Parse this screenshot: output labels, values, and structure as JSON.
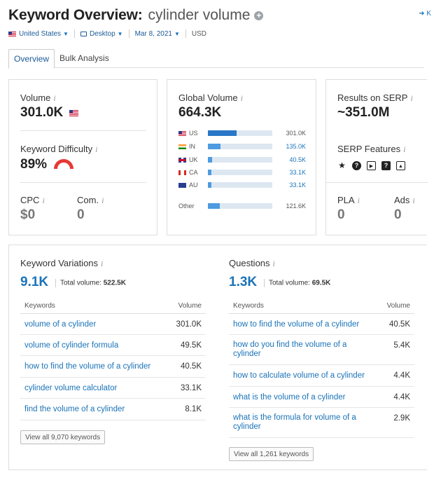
{
  "header": {
    "title": "Keyword Overview:",
    "keyword": "cylinder volume",
    "add_icon": "plus-circle-icon",
    "kb_link": "K"
  },
  "filters": {
    "country": "United States",
    "device": "Desktop",
    "date": "Mar 8, 2021",
    "currency": "USD"
  },
  "tabs": [
    {
      "label": "Overview",
      "active": true
    },
    {
      "label": "Bulk Analysis",
      "active": false
    }
  ],
  "summary": {
    "volume": {
      "label": "Volume",
      "value": "301.0K"
    },
    "difficulty": {
      "label": "Keyword Difficulty",
      "value": "89%",
      "color": "#e53935"
    },
    "cpc": {
      "label": "CPC",
      "value": "$0"
    },
    "com": {
      "label": "Com.",
      "value": "0"
    }
  },
  "global": {
    "label": "Global Volume",
    "value": "664.3K",
    "countries": [
      {
        "code": "US",
        "value": "301.0K",
        "share": 0.45,
        "link": false
      },
      {
        "code": "IN",
        "value": "135.0K",
        "share": 0.2,
        "link": true
      },
      {
        "code": "UK",
        "value": "40.5K",
        "share": 0.06,
        "link": true
      },
      {
        "code": "CA",
        "value": "33.1K",
        "share": 0.05,
        "link": true
      },
      {
        "code": "AU",
        "value": "33.1K",
        "share": 0.05,
        "link": true
      }
    ],
    "other": {
      "label": "Other",
      "value": "121.6K",
      "share": 0.18
    }
  },
  "serp": {
    "results": {
      "label": "Results on SERP",
      "value": "~351.0M"
    },
    "features": {
      "label": "SERP Features",
      "icons": [
        "star-icon",
        "question-circle-icon",
        "video-play-icon",
        "faq-icon",
        "image-icon"
      ]
    },
    "pla": {
      "label": "PLA",
      "value": "0"
    },
    "ads": {
      "label": "Ads",
      "value": "0"
    }
  },
  "variations": {
    "title": "Keyword Variations",
    "count": "9.1K",
    "total_label": "Total volume:",
    "total_value": "522.5K",
    "col_keywords": "Keywords",
    "col_volume": "Volume",
    "rows": [
      {
        "keyword": "volume of a cylinder",
        "volume": "301.0K"
      },
      {
        "keyword": "volume of cylinder formula",
        "volume": "49.5K"
      },
      {
        "keyword": "how to find the volume of a cylinder",
        "volume": "40.5K"
      },
      {
        "keyword": "cylinder volume calculator",
        "volume": "33.1K"
      },
      {
        "keyword": "find the volume of a cylinder",
        "volume": "8.1K"
      }
    ],
    "view_all": "View all 9,070 keywords"
  },
  "questions": {
    "title": "Questions",
    "count": "1.3K",
    "total_label": "Total volume:",
    "total_value": "69.5K",
    "col_keywords": "Keywords",
    "col_volume": "Volume",
    "rows": [
      {
        "keyword": "how to find the volume of a cylinder",
        "volume": "40.5K"
      },
      {
        "keyword": "how do you find the volume of a cylinder",
        "volume": "5.4K"
      },
      {
        "keyword": "how to calculate volume of a cylinder",
        "volume": "4.4K"
      },
      {
        "keyword": "what is the volume of a cylinder",
        "volume": "4.4K"
      },
      {
        "keyword": "what is the formula for volume of a cylinder",
        "volume": "2.9K"
      }
    ],
    "view_all": "View all 1,261 keywords"
  },
  "colors": {
    "accent": "#1a73b8",
    "bar": "#4d9be0",
    "bar_track": "#dde7f1",
    "difficulty": "#e53935"
  }
}
